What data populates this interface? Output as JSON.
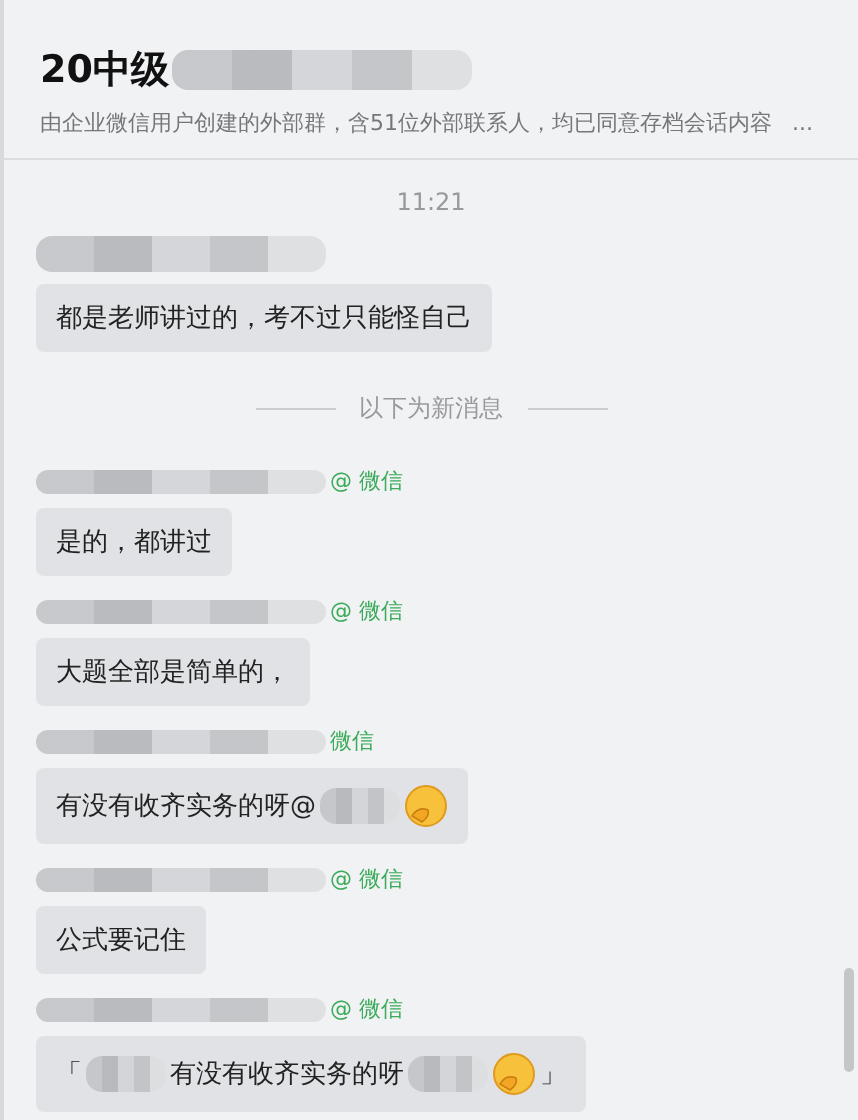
{
  "header": {
    "title": "20中级",
    "subtitle": "由企业微信用户创建的外部群，含51位外部联系人，均已同意存档会话内容",
    "more": "..."
  },
  "items": [
    {
      "kind": "time",
      "text": "11:21"
    },
    {
      "kind": "message",
      "parts": [
        {
          "kind": "text",
          "text": "都是老师讲过的，考不过只能怪自己"
        }
      ]
    },
    {
      "kind": "divider",
      "text": "以下为新消息"
    },
    {
      "kind": "message",
      "tag": "@ 微信",
      "parts": [
        {
          "kind": "text",
          "text": "是的，都讲过"
        }
      ]
    },
    {
      "kind": "message",
      "tag": "@ 微信",
      "parts": [
        {
          "kind": "text",
          "text": "大题全部是简单的，"
        }
      ]
    },
    {
      "kind": "message",
      "tag": "微信",
      "parts": [
        {
          "kind": "text",
          "text": "有没有收齐实务的呀@"
        },
        {
          "kind": "blur"
        },
        {
          "kind": "emoji"
        }
      ]
    },
    {
      "kind": "message",
      "tag": "@ 微信",
      "parts": [
        {
          "kind": "text",
          "text": "公式要记住"
        }
      ]
    },
    {
      "kind": "message",
      "tag": "@ 微信",
      "parts": [
        {
          "kind": "text",
          "text": "「"
        },
        {
          "kind": "blur"
        },
        {
          "kind": "text",
          "text": "有没有收齐实务的呀"
        },
        {
          "kind": "blur"
        },
        {
          "kind": "emoji"
        },
        {
          "kind": "text",
          "text": "」"
        }
      ]
    }
  ]
}
